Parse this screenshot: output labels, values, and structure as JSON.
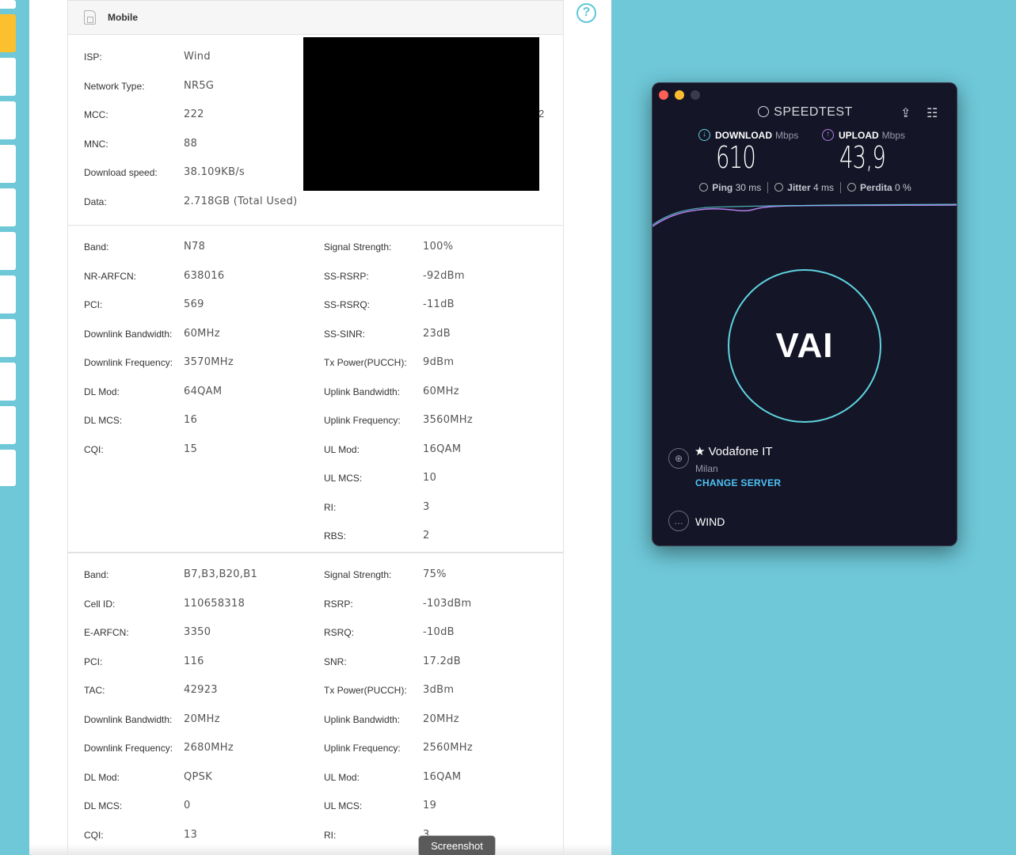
{
  "router": {
    "mobile_card": {
      "title": "Mobile",
      "rows": [
        {
          "label": "ISP:",
          "value": "Wind"
        },
        {
          "label": "Network Type:",
          "value": "NR5G"
        },
        {
          "label": "MCC:",
          "value": "222"
        },
        {
          "label": "MNC:",
          "value": "88"
        },
        {
          "label": "Download speed:",
          "value": "38.109KB/s"
        },
        {
          "label": "Data:",
          "value": "2.718GB (Total Used)"
        }
      ],
      "stray_text": "2"
    },
    "nr_card": {
      "left": [
        {
          "label": "Band:",
          "value": "N78"
        },
        {
          "label": "NR-ARFCN:",
          "value": "638016"
        },
        {
          "label": "PCI:",
          "value": "569"
        },
        {
          "label": "Downlink Bandwidth:",
          "value": "60MHz"
        },
        {
          "label": "Downlink Frequency:",
          "value": "3570MHz"
        },
        {
          "label": "DL Mod:",
          "value": "64QAM"
        },
        {
          "label": "DL MCS:",
          "value": "16"
        },
        {
          "label": "CQI:",
          "value": "15"
        }
      ],
      "right": [
        {
          "label": "Signal Strength:",
          "value": "100%"
        },
        {
          "label": "SS-RSRP:",
          "value": "-92dBm"
        },
        {
          "label": "SS-RSRQ:",
          "value": "-11dB"
        },
        {
          "label": "SS-SINR:",
          "value": "23dB"
        },
        {
          "label": "Tx Power(PUCCH):",
          "value": "9dBm"
        },
        {
          "label": "Uplink Bandwidth:",
          "value": "60MHz"
        },
        {
          "label": "Uplink Frequency:",
          "value": "3560MHz"
        },
        {
          "label": "UL Mod:",
          "value": "16QAM"
        },
        {
          "label": "UL MCS:",
          "value": "10"
        },
        {
          "label": "RI:",
          "value": "3"
        },
        {
          "label": "RBS:",
          "value": "2"
        }
      ]
    },
    "lte_card": {
      "left": [
        {
          "label": "Band:",
          "value": "B7,B3,B20,B1"
        },
        {
          "label": "Cell ID:",
          "value": "110658318"
        },
        {
          "label": "E-ARFCN:",
          "value": "3350"
        },
        {
          "label": "PCI:",
          "value": "116"
        },
        {
          "label": "TAC:",
          "value": "42923"
        },
        {
          "label": "Downlink Bandwidth:",
          "value": "20MHz"
        },
        {
          "label": "Downlink Frequency:",
          "value": "2680MHz"
        },
        {
          "label": "DL Mod:",
          "value": "QPSK"
        },
        {
          "label": "DL MCS:",
          "value": "0"
        },
        {
          "label": "CQI:",
          "value": "13"
        }
      ],
      "right": [
        {
          "label": "Signal Strength:",
          "value": "75%"
        },
        {
          "label": "RSRP:",
          "value": "-103dBm"
        },
        {
          "label": "RSRQ:",
          "value": "-10dB"
        },
        {
          "label": "SNR:",
          "value": "17.2dB"
        },
        {
          "label": "Tx Power(PUCCH):",
          "value": "3dBm"
        },
        {
          "label": "Uplink Bandwidth:",
          "value": "20MHz"
        },
        {
          "label": "Uplink Frequency:",
          "value": "2560MHz"
        },
        {
          "label": "UL Mod:",
          "value": "16QAM"
        },
        {
          "label": "UL MCS:",
          "value": "19"
        },
        {
          "label": "RI:",
          "value": "3"
        }
      ]
    },
    "help_icon": "question-circle-icon"
  },
  "screenshot_button": "Screenshot",
  "speedtest": {
    "title": "SPEEDTEST",
    "download": {
      "label": "DOWNLOAD",
      "unit": "Mbps",
      "value": "610",
      "color": "#5fd3e0"
    },
    "upload": {
      "label": "UPLOAD",
      "unit": "Mbps",
      "value": "43,9",
      "color": "#b37feb"
    },
    "ping": {
      "label": "Ping",
      "value": "30 ms"
    },
    "jitter": {
      "label": "Jitter",
      "value": "4 ms"
    },
    "loss": {
      "label": "Perdita",
      "value": "0 %"
    },
    "go_label": "VAI",
    "server": {
      "name": "Vodafone IT",
      "city": "Milan",
      "change": "CHANGE SERVER"
    },
    "isp": "WIND",
    "accent_cyan": "#5fd3e0",
    "accent_purple": "#b37feb",
    "background": "#141526"
  }
}
